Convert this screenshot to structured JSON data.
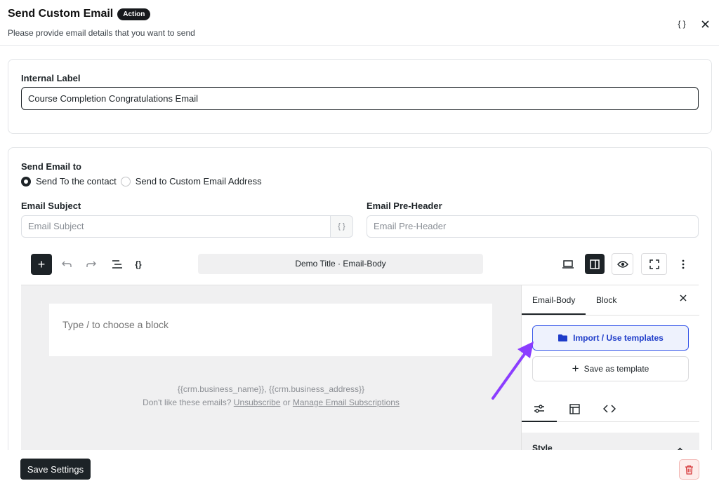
{
  "header": {
    "title": "Send Custom Email",
    "badge": "Action",
    "subtitle": "Please provide email details that you want to send",
    "icons": [
      "braces-icon",
      "close-icon"
    ]
  },
  "internal_label": {
    "label": "Internal Label",
    "value": "Course Completion Congratulations Email"
  },
  "send_to": {
    "label": "Send Email to",
    "options": [
      "Send To the contact",
      "Send to Custom Email Address"
    ],
    "selected": "Send To the contact"
  },
  "subject": {
    "label": "Email Subject",
    "placeholder": "Email Subject",
    "suffix": "{ }"
  },
  "preheader": {
    "label": "Email Pre-Header",
    "placeholder": "Email Pre-Header"
  },
  "editor": {
    "doc_title": "Demo Title · Email-Body",
    "block_placeholder": "Type / to choose a block",
    "footer_line1": "{{crm.business_name}}, {{crm.business_address}}",
    "footer_prefix": "Don't like these emails?",
    "unsubscribe": "Unsubscribe",
    "footer_or": "or",
    "manage": "Manage Email Subscriptions"
  },
  "sidebar": {
    "tab_email_body": "Email-Body",
    "tab_block": "Block",
    "import_label": "Import / Use templates",
    "save_template_label": "Save as template",
    "style_label": "Style"
  },
  "footer": {
    "save_label": "Save Settings"
  }
}
